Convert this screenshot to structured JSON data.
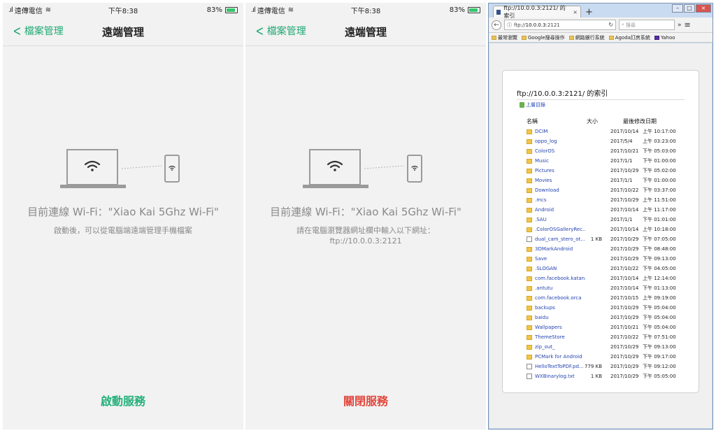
{
  "status": {
    "carrier": "遠傳電信",
    "time": "下午8:38",
    "battery": "83%"
  },
  "phone1": {
    "back_label": "檔案管理",
    "title": "遠端管理",
    "connection": "目前連線 Wi-Fi：\"Xiao Kai 5Ghz Wi-Fi\"",
    "sub_line1": "啟動後，可以從電腦端遠端管理手機檔案",
    "sub_line2": "",
    "action": "啟動服務"
  },
  "phone2": {
    "back_label": "檔案管理",
    "title": "遠端管理",
    "connection": "目前連線 Wi-Fi：\"Xiao Kai 5Ghz Wi-Fi\"",
    "sub_line1": "請在電腦瀏覽器網址欄中輸入以下網址：",
    "sub_line2": "ftp://10.0.0.3:2121",
    "action": "關閉服務"
  },
  "browser": {
    "tab_title": "ftp://10.0.0.3:2121/ 的索引",
    "url_prefix": "ftp://",
    "url_host": "10.0.0.3",
    "url_port": ":2121",
    "search_placeholder": "搜尋",
    "bookmarks": [
      {
        "label": "最常瀏覽",
        "icon": "folder-icon"
      },
      {
        "label": "Google搜尋操作",
        "icon": "folder-icon"
      },
      {
        "label": "網路銀行系統",
        "icon": "folder-icon"
      },
      {
        "label": "Agoda訂房系統",
        "icon": "folder-icon"
      },
      {
        "label": "Yahoo",
        "icon": "yahoo-icon"
      }
    ],
    "page_title": "ftp://10.0.0.3:2121/ 的索引",
    "up_label": "上層目錄",
    "col_name": "名稱",
    "col_size": "大小",
    "col_modified": "最後修改日期",
    "rows": [
      {
        "name": "DCIM",
        "size": "",
        "date": "2017/10/14",
        "time": "上午 10:17:00",
        "type": "folder"
      },
      {
        "name": "oppo_log",
        "size": "",
        "date": "2017/5/4",
        "time": "上午 03:23:00",
        "type": "folder"
      },
      {
        "name": "ColorOS",
        "size": "",
        "date": "2017/10/21",
        "time": "下午 05:03:00",
        "type": "folder"
      },
      {
        "name": "Music",
        "size": "",
        "date": "2017/1/1",
        "time": "下午 01:00:00",
        "type": "folder"
      },
      {
        "name": "Pictures",
        "size": "",
        "date": "2017/10/29",
        "time": "下午 05:02:00",
        "type": "folder"
      },
      {
        "name": "Movies",
        "size": "",
        "date": "2017/1/1",
        "time": "下午 01:00:00",
        "type": "folder"
      },
      {
        "name": "Download",
        "size": "",
        "date": "2017/10/22",
        "time": "下午 03:37:00",
        "type": "folder"
      },
      {
        "name": ".mcs",
        "size": "",
        "date": "2017/10/29",
        "time": "上午 11:51:00",
        "type": "folder"
      },
      {
        "name": "Android",
        "size": "",
        "date": "2017/10/14",
        "time": "上午 11:17:00",
        "type": "folder"
      },
      {
        "name": ".SAU",
        "size": "",
        "date": "2017/1/1",
        "time": "下午 01:01:00",
        "type": "folder"
      },
      {
        "name": ".ColorOSGalleryRec...",
        "size": "",
        "date": "2017/10/14",
        "time": "上午 10:18:00",
        "type": "folder"
      },
      {
        "name": "dual_cam_stero_ot...",
        "size": "1 KB",
        "date": "2017/10/29",
        "time": "下午 07:05:00",
        "type": "file"
      },
      {
        "name": "3DMarkAndroid",
        "size": "",
        "date": "2017/10/29",
        "time": "下午 08:48:00",
        "type": "folder"
      },
      {
        "name": "Save",
        "size": "",
        "date": "2017/10/29",
        "time": "下午 09:13:00",
        "type": "folder"
      },
      {
        "name": ".SLOGAN",
        "size": "",
        "date": "2017/10/22",
        "time": "下午 04:05:00",
        "type": "folder"
      },
      {
        "name": "com.facebook.katana",
        "size": "",
        "date": "2017/10/14",
        "time": "上午 12:14:00",
        "type": "folder"
      },
      {
        "name": ".antutu",
        "size": "",
        "date": "2017/10/14",
        "time": "下午 01:13:00",
        "type": "folder"
      },
      {
        "name": "com.facebook.orca",
        "size": "",
        "date": "2017/10/15",
        "time": "上午 09:19:00",
        "type": "folder"
      },
      {
        "name": "backups",
        "size": "",
        "date": "2017/10/29",
        "time": "下午 05:04:00",
        "type": "folder"
      },
      {
        "name": "baidu",
        "size": "",
        "date": "2017/10/29",
        "time": "下午 05:04:00",
        "type": "folder"
      },
      {
        "name": "Wallpapers",
        "size": "",
        "date": "2017/10/21",
        "time": "下午 05:04:00",
        "type": "folder"
      },
      {
        "name": "ThemeStore",
        "size": "",
        "date": "2017/10/22",
        "time": "下午 07:51:00",
        "type": "folder"
      },
      {
        "name": "zip_out_",
        "size": "",
        "date": "2017/10/29",
        "time": "下午 09:13:00",
        "type": "folder"
      },
      {
        "name": "PCMark for Android",
        "size": "",
        "date": "2017/10/29",
        "time": "下午 09:17:00",
        "type": "folder"
      },
      {
        "name": "HelloTextToPDF.pd...",
        "size": "779 KB",
        "date": "2017/10/29",
        "time": "下午 09:12:00",
        "type": "file"
      },
      {
        "name": "WXBinarylog.txt",
        "size": "1 KB",
        "date": "2017/10/29",
        "time": "下午 05:05:00",
        "type": "file"
      }
    ]
  },
  "colors": {
    "accent_green": "#24b07a",
    "stop_red": "#e2463c",
    "link_blue": "#2644b0"
  }
}
